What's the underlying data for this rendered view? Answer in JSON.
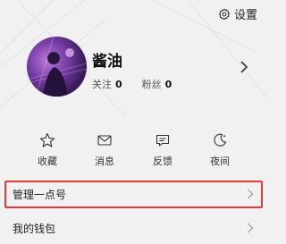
{
  "header": {
    "settings_label": "设置"
  },
  "profile": {
    "nickname": "酱油",
    "following_label": "关注",
    "following_count": "0",
    "followers_label": "粉丝",
    "followers_count": "0"
  },
  "actions": [
    {
      "label": "收藏",
      "icon": "star-icon"
    },
    {
      "label": "消息",
      "icon": "mail-icon"
    },
    {
      "label": "反馈",
      "icon": "feedback-icon"
    },
    {
      "label": "夜间",
      "icon": "moon-icon"
    }
  ],
  "menu": {
    "manage_label": "管理一点号",
    "wallet_label": "我的钱包"
  },
  "colors": {
    "highlight": "#e23b3b",
    "background": "#f1f1f1"
  }
}
